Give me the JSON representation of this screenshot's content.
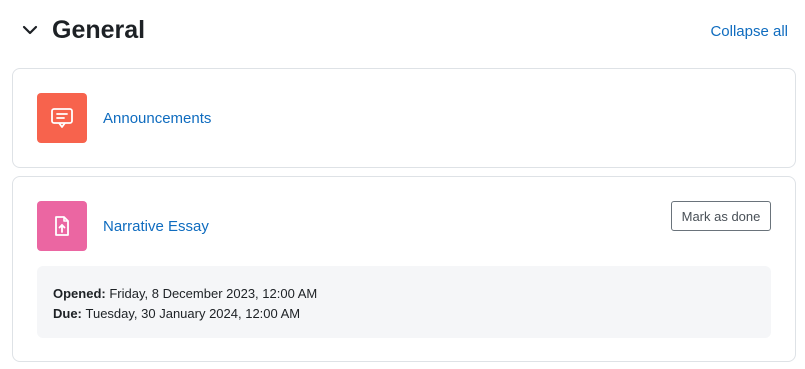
{
  "section": {
    "title": "General",
    "collapse_all_label": "Collapse all"
  },
  "activities": [
    {
      "name": "Announcements",
      "icon": "forum-icon",
      "icon_color": "#f7634d"
    },
    {
      "name": "Narrative Essay",
      "icon": "assignment-upload-icon",
      "icon_color": "#eb66a2",
      "mark_done_label": "Mark as done",
      "opened_label": "Opened:",
      "opened_value": "Friday, 8 December 2023, 12:00 AM",
      "due_label": "Due:",
      "due_value": "Tuesday, 30 January 2024, 12:00 AM"
    }
  ],
  "colors": {
    "link": "#0f6cbf",
    "text": "#1d2125",
    "border": "#dee2e6"
  }
}
